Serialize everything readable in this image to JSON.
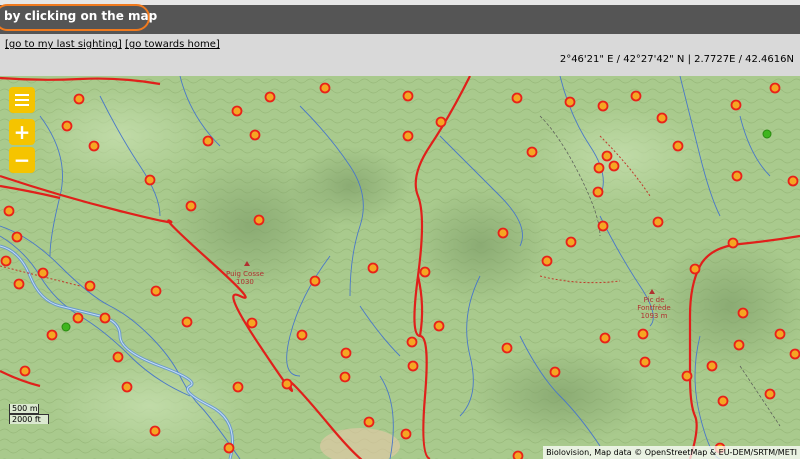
{
  "header": {
    "title": "by clicking on the map"
  },
  "links": {
    "last_sighting": "[go to my last sighting]",
    "towards_home": "[go towards home]"
  },
  "coords": "2°46'21\" E / 42°27'42\" N | 2.7727E / 42.4616N",
  "controls": {
    "zoom_in": "+",
    "zoom_out": "−"
  },
  "scale": {
    "metric": "500 m",
    "imperial": "2000 ft"
  },
  "attribution": "Biolovision, Map data © OpenStreetMap & EU-DEM/SRTM/METI",
  "peaks": [
    {
      "name": "Puig Cosse",
      "elev": "1030"
    },
    {
      "name": "Pic de Fontfrède",
      "elev": "1093 m"
    }
  ],
  "colors": {
    "map_bg": "#a8c98c",
    "marker_fill": "#f5a623",
    "marker_ring": "#e8221a",
    "green_marker": "#3fb51e",
    "road": "#e0201b",
    "river": "#4a78c8",
    "control": "#f5c400",
    "header": "#555555",
    "pill_border": "#f07a1e"
  }
}
